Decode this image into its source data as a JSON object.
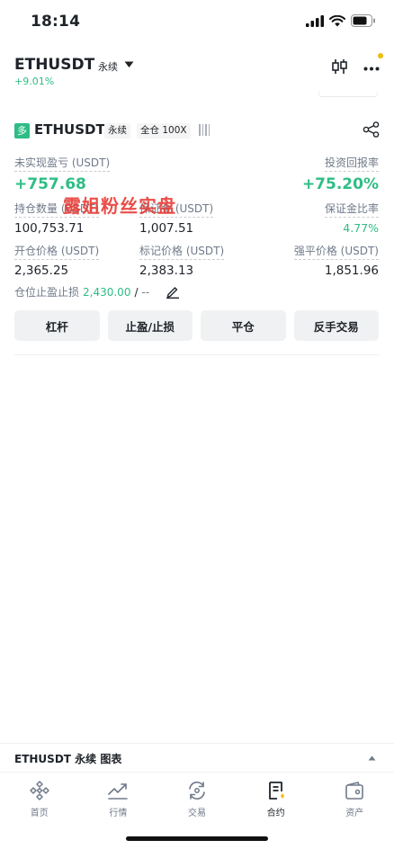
{
  "status_bar": {
    "time": "18:14"
  },
  "header": {
    "symbol": "ETHUSDT",
    "contract_type": "永续",
    "change": "+9.01%"
  },
  "position": {
    "side_badge": "多",
    "symbol": "ETHUSDT",
    "contract_type": "永续",
    "margin_mode": "全仓 100X",
    "unrealized_pnl_label": "未实现盈亏 (USDT)",
    "unrealized_pnl": "+757.68",
    "roe_label": "投资回报率",
    "roe": "+75.20%",
    "size_label": "持仓数量 (USDT)",
    "size": "100,753.71",
    "margin_label": "保证金 (USDT)",
    "margin": "1,007.51",
    "margin_ratio_label": "保证金比率",
    "margin_ratio": "4.77%",
    "entry_price_label": "开仓价格 (USDT)",
    "entry_price": "2,365.25",
    "mark_price_label": "标记价格 (USDT)",
    "mark_price": "2,383.13",
    "liq_price_label": "强平价格 (USDT)",
    "liq_price": "1,851.96",
    "tpsl_label": "仓位止盈止损",
    "tp_value": "2,430.00",
    "tpsl_separator": "/",
    "sl_value": "--"
  },
  "watermark": "露姐粉丝实盘",
  "actions": {
    "leverage": "杠杆",
    "tpsl": "止盈/止损",
    "close": "平仓",
    "reverse": "反手交易"
  },
  "chart_bar": {
    "label": "ETHUSDT 永续 图表"
  },
  "tabbar": {
    "items": [
      {
        "label": "首页",
        "icon": "home-icon"
      },
      {
        "label": "行情",
        "icon": "markets-icon"
      },
      {
        "label": "交易",
        "icon": "trade-icon"
      },
      {
        "label": "合约",
        "icon": "futures-icon"
      },
      {
        "label": "资产",
        "icon": "wallet-icon"
      }
    ]
  },
  "colors": {
    "green": "#2ebd85",
    "accent": "#f0b90b",
    "watermark": "#e8403a"
  }
}
